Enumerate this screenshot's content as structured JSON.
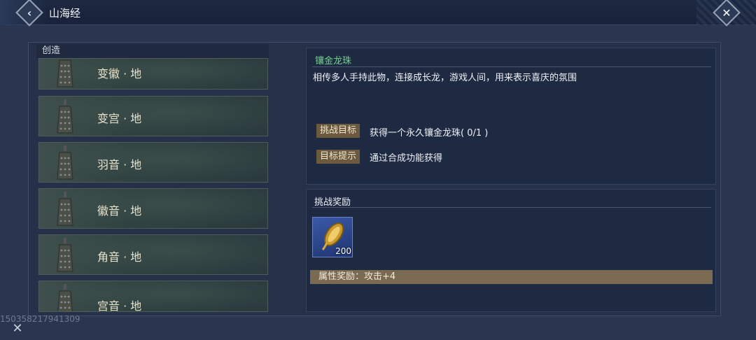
{
  "header": {
    "title": "山海经",
    "back_icon": "‹",
    "close_icon": "✕"
  },
  "list": {
    "section_label": "创造",
    "items": [
      {
        "label": "变徽 · 地"
      },
      {
        "label": "变宫 · 地"
      },
      {
        "label": "羽音 · 地"
      },
      {
        "label": "徽音 · 地"
      },
      {
        "label": "角音 · 地"
      },
      {
        "label": "宫音 · 地"
      }
    ]
  },
  "detail": {
    "name": "镶金龙珠",
    "name_color": "#6fd28a",
    "description": "相传多人手持此物，连接成长龙，游戏人间，用来表示喜庆的氛围",
    "goal_tag": "挑战目标",
    "goal_text": "获得一个永久镶金龙珠( 0/1 )",
    "hint_tag": "目标提示",
    "hint_text": "通过合成功能获得"
  },
  "reward": {
    "title": "挑战奖励",
    "item_icon": "golden-coin-string-icon",
    "count": "200",
    "attribute": "属性奖励：攻击+4"
  },
  "footer": {
    "watermark": "1503582179413​09",
    "close_icon": "✕"
  }
}
